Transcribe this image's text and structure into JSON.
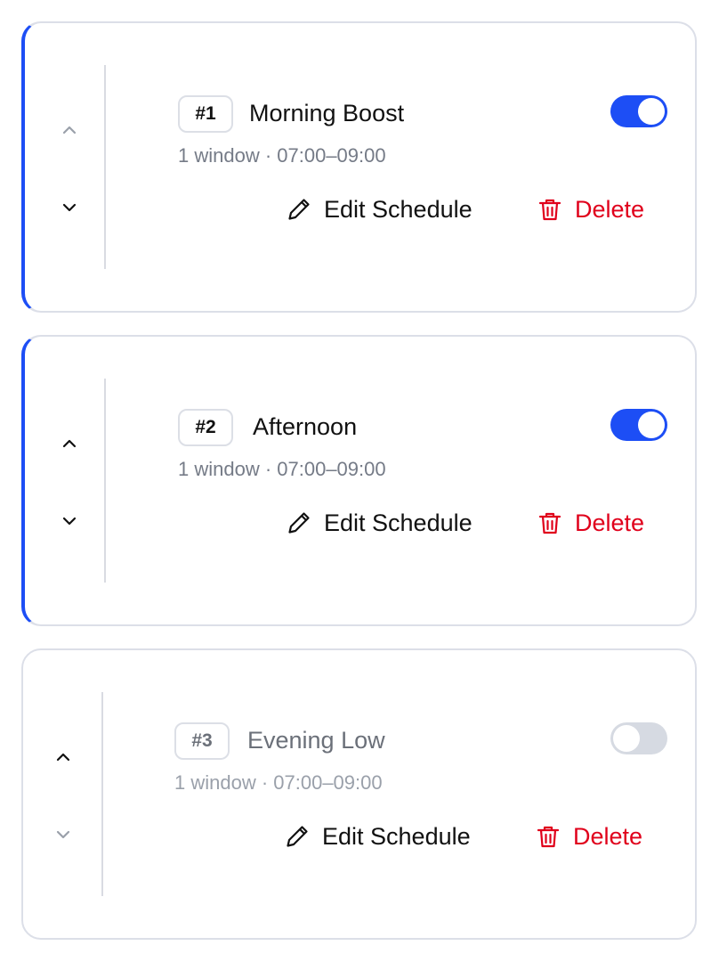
{
  "cards": [
    {
      "rank": "#1",
      "name": "Morning Boost",
      "meta": "1 window · 07:00–09:00",
      "enabled": true,
      "edit_label": "Edit Schedule",
      "delete_label": "Delete",
      "up_enabled": false,
      "down_enabled": true
    },
    {
      "rank": "#2",
      "name": "Afternoon",
      "meta": "1 window · 07:00–09:00",
      "enabled": true,
      "edit_label": "Edit Schedule",
      "delete_label": "Delete",
      "up_enabled": true,
      "down_enabled": true
    },
    {
      "rank": "#3",
      "name": "Evening Low",
      "meta": "1 window · 07:00–09:00",
      "enabled": false,
      "edit_label": "Edit Schedule",
      "delete_label": "Delete",
      "up_enabled": true,
      "down_enabled": false
    }
  ],
  "colors": {
    "accent": "#1d4ef5",
    "danger": "#e0001b",
    "toggle_off": "#d6dae2",
    "arrow_disabled": "#9aa0aa",
    "arrow_enabled": "#111111"
  },
  "icons": {
    "up": "chevron-up-icon",
    "down": "chevron-down-icon",
    "edit": "pencil-icon",
    "delete": "trash-icon"
  }
}
